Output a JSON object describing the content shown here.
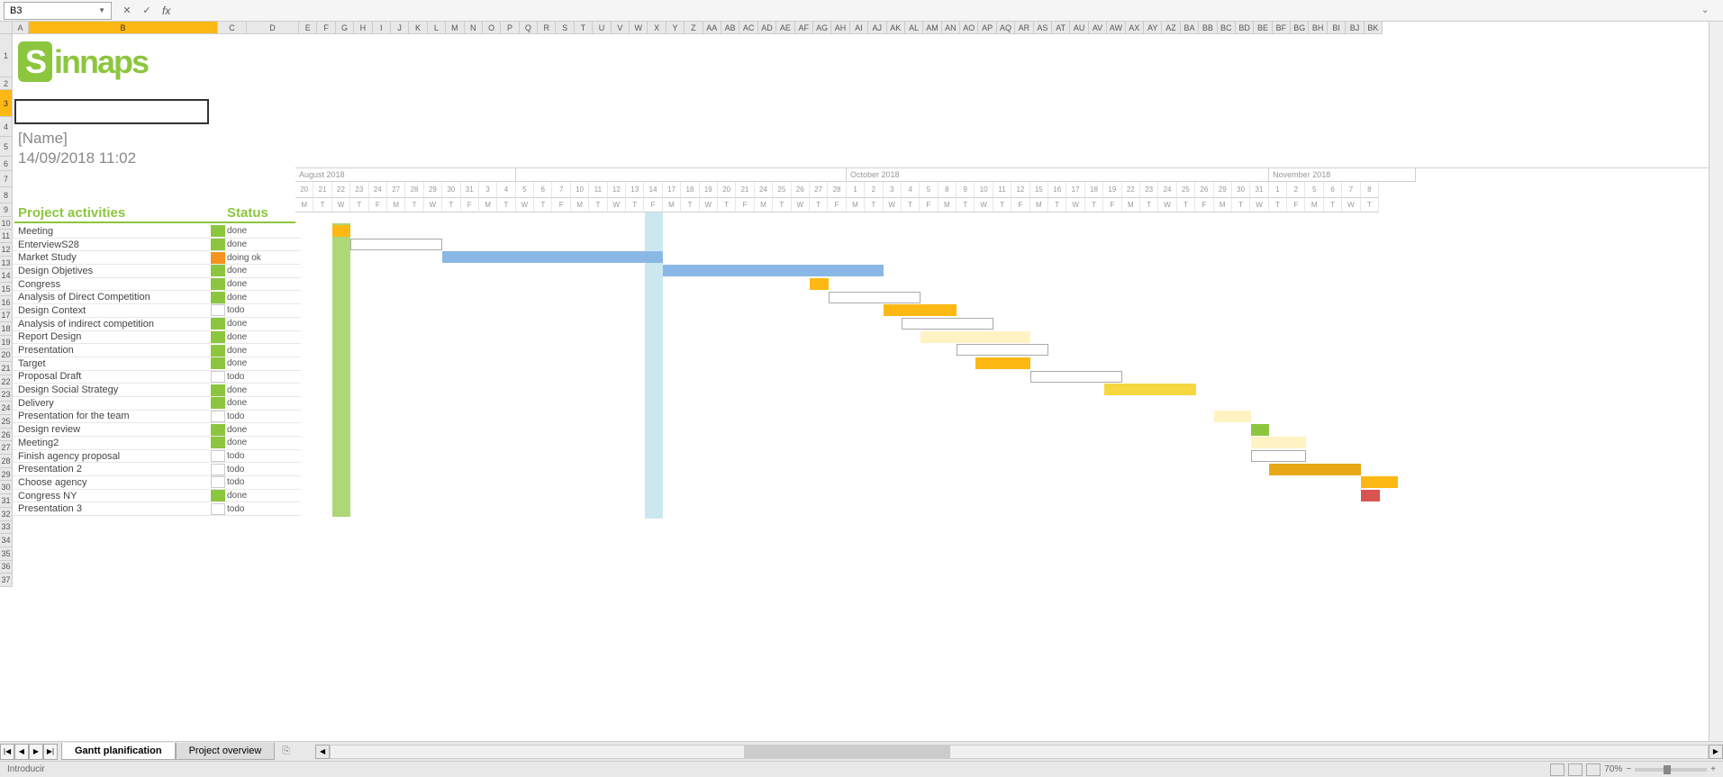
{
  "cell_ref": "B3",
  "logo_text": "innaps",
  "name_placeholder": "[Name]",
  "date_text": "14/09/2018 11:02",
  "activities_header": "Project activities",
  "status_header": "Status",
  "columns": [
    "A",
    "B",
    "C",
    "D",
    "E",
    "F",
    "G",
    "H",
    "I",
    "J",
    "K",
    "L",
    "M",
    "N",
    "O",
    "P",
    "Q",
    "R",
    "S",
    "T",
    "U",
    "V",
    "W",
    "X",
    "Y",
    "Z",
    "AA",
    "AB",
    "AC",
    "AD",
    "AE",
    "AF",
    "AG",
    "AH",
    "AI",
    "AJ",
    "AK",
    "AL",
    "AM",
    "AN",
    "AO",
    "AP",
    "AQ",
    "AR",
    "AS",
    "AT",
    "AU",
    "AV",
    "AW",
    "AX",
    "AY",
    "AZ",
    "BA",
    "BB",
    "BC",
    "BD",
    "BE",
    "BF",
    "BG",
    "BH",
    "BI",
    "BJ",
    "BK"
  ],
  "col_widths": {
    "A": 18,
    "B": 210,
    "C": 32,
    "D": 58
  },
  "rows": [
    1,
    2,
    3,
    4,
    5,
    6,
    7,
    8,
    9,
    10,
    11,
    12,
    13,
    14,
    15,
    16,
    17,
    18,
    19,
    20,
    21,
    22,
    23,
    24,
    25,
    26,
    27,
    28,
    29,
    30,
    31,
    32,
    33,
    34,
    35,
    36,
    37
  ],
  "months": [
    {
      "label": "August 2018",
      "days": 12
    },
    {
      "label": "",
      "days": 18
    },
    {
      "label": "October 2018",
      "days": 23
    },
    {
      "label": "November 2018",
      "days": 8
    }
  ],
  "day_nums": [
    "20",
    "21",
    "22",
    "23",
    "24",
    "27",
    "28",
    "29",
    "30",
    "31",
    "3",
    "4",
    "5",
    "6",
    "7",
    "10",
    "11",
    "12",
    "13",
    "14",
    "17",
    "18",
    "19",
    "20",
    "21",
    "24",
    "25",
    "26",
    "27",
    "28",
    "1",
    "2",
    "3",
    "4",
    "5",
    "8",
    "9",
    "10",
    "11",
    "12",
    "15",
    "16",
    "17",
    "18",
    "19",
    "22",
    "23",
    "24",
    "25",
    "26",
    "29",
    "30",
    "31",
    "1",
    "2",
    "5",
    "6",
    "7",
    "8"
  ],
  "day_wk": [
    "M",
    "T",
    "W",
    "T",
    "F",
    "M",
    "T",
    "W",
    "T",
    "F",
    "M",
    "T",
    "W",
    "T",
    "F",
    "M",
    "T",
    "W",
    "T",
    "F",
    "M",
    "T",
    "W",
    "T",
    "F",
    "M",
    "T",
    "W",
    "T",
    "F",
    "M",
    "T",
    "W",
    "T",
    "F",
    "M",
    "T",
    "W",
    "T",
    "F",
    "M",
    "T",
    "W",
    "T",
    "F",
    "M",
    "T",
    "W",
    "T",
    "F",
    "M",
    "T",
    "W",
    "T",
    "F",
    "M",
    "T",
    "W",
    "T"
  ],
  "activities": [
    {
      "name": "Meeting",
      "status": "done",
      "chip": "green",
      "bar": {
        "start": 2,
        "width": 1,
        "color": "#fdb813"
      }
    },
    {
      "name": "EnterviewS28",
      "status": "done",
      "chip": "green",
      "bar": {
        "start": 3,
        "width": 5,
        "color": "#ffffff",
        "border": true
      }
    },
    {
      "name": "Market Study",
      "status": "doing ok",
      "chip": "orange",
      "bar": {
        "start": 8,
        "width": 12,
        "color": "#8ab8e6"
      }
    },
    {
      "name": "Design Objetives",
      "status": "done",
      "chip": "green",
      "bar": {
        "start": 20,
        "width": 12,
        "color": "#8ab8e6"
      }
    },
    {
      "name": "Congress",
      "status": "done",
      "chip": "green",
      "bar": {
        "start": 28,
        "width": 1,
        "color": "#fdb813"
      }
    },
    {
      "name": "Analysis of Direct Competition",
      "status": "done",
      "chip": "green",
      "bar": {
        "start": 29,
        "width": 5,
        "color": "#ffffff",
        "border": true
      }
    },
    {
      "name": "Design Context",
      "status": "todo",
      "chip": "white",
      "bar": {
        "start": 32,
        "width": 4,
        "color": "#fdb813"
      }
    },
    {
      "name": "Analysis of indirect competition",
      "status": "done",
      "chip": "green",
      "bar": {
        "start": 33,
        "width": 5,
        "color": "#ffffff",
        "border": true
      }
    },
    {
      "name": "Report Design",
      "status": "done",
      "chip": "green",
      "bar": {
        "start": 34,
        "width": 6,
        "color": "#fff3c4"
      }
    },
    {
      "name": "Presentation",
      "status": "done",
      "chip": "green",
      "bar": {
        "start": 36,
        "width": 5,
        "color": "#ffffff",
        "border": true
      }
    },
    {
      "name": "Target",
      "status": "done",
      "chip": "green",
      "bar": {
        "start": 37,
        "width": 3,
        "color": "#fdb813"
      }
    },
    {
      "name": "Proposal Draft",
      "status": "todo",
      "chip": "white",
      "bar": {
        "start": 40,
        "width": 5,
        "color": "#ffffff",
        "border": true
      }
    },
    {
      "name": "Design Social Strategy",
      "status": "done",
      "chip": "green",
      "bar": {
        "start": 44,
        "width": 5,
        "color": "#f5d73f"
      }
    },
    {
      "name": "Delivery",
      "status": "done",
      "chip": "green"
    },
    {
      "name": "Presentation for the team",
      "status": "todo",
      "chip": "white",
      "bar": {
        "start": 50,
        "width": 2,
        "color": "#fff3c4"
      }
    },
    {
      "name": "Design review",
      "status": "done",
      "chip": "green",
      "bar": {
        "start": 52,
        "width": 1,
        "color": "#8cc63f"
      }
    },
    {
      "name": "Meeting2",
      "status": "done",
      "chip": "green",
      "bar": {
        "start": 52,
        "width": 3,
        "color": "#fff3c4"
      }
    },
    {
      "name": "Finish agency proposal",
      "status": "todo",
      "chip": "white",
      "bar": {
        "start": 52,
        "width": 3,
        "color": "#ffffff",
        "border": true
      }
    },
    {
      "name": "Presentation 2",
      "status": "todo",
      "chip": "white",
      "bar": {
        "start": 53,
        "width": 5,
        "color": "#e6a817"
      }
    },
    {
      "name": "Choose agency",
      "status": "todo",
      "chip": "white",
      "bar": {
        "start": 58,
        "width": 2,
        "color": "#fdb813"
      }
    },
    {
      "name": "Congress NY",
      "status": "done",
      "chip": "green",
      "bar": {
        "start": 58,
        "width": 1,
        "color": "#d9534f"
      }
    },
    {
      "name": "Presentation 3",
      "status": "todo",
      "chip": "white"
    }
  ],
  "today_col_index": 19,
  "green_col_index": 2,
  "tabs": [
    {
      "label": "Gantt planification",
      "active": true
    },
    {
      "label": "Project overview",
      "active": false
    }
  ],
  "status_text": "Introducir",
  "zoom": "70%"
}
